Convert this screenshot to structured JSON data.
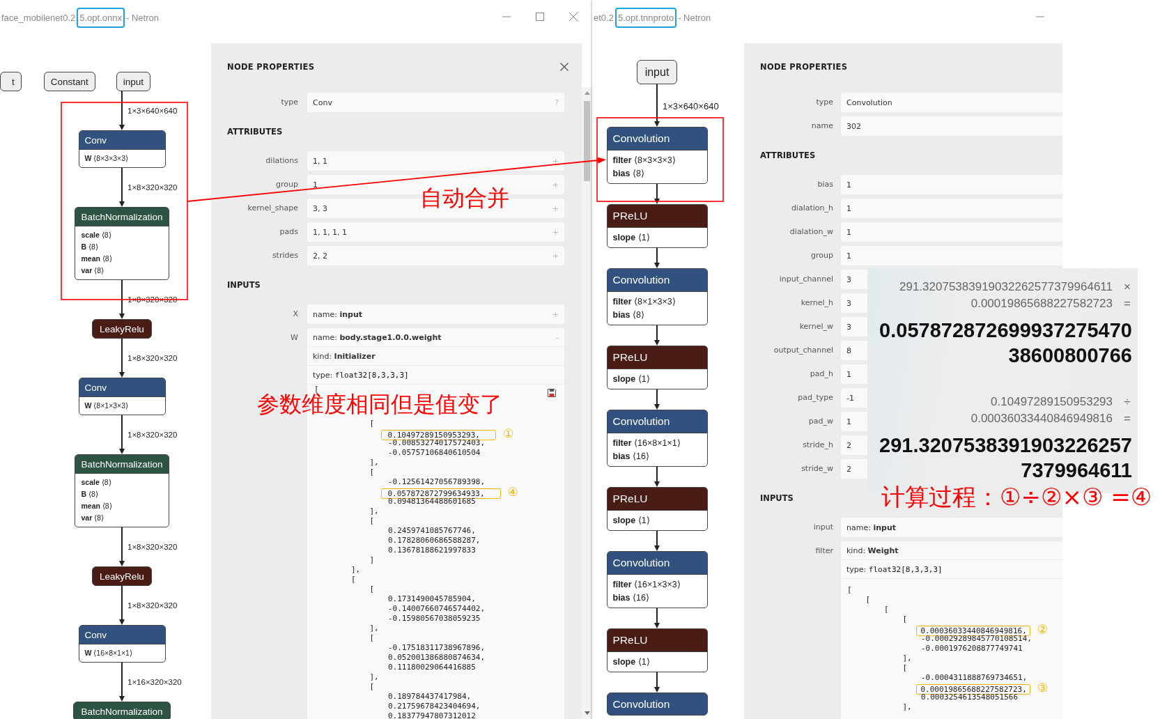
{
  "left_window": {
    "title": {
      "before": "face_mobilenet0.2",
      "highlighted": "5.opt.onnx",
      "after": " - Netron"
    },
    "controls": {
      "minimize": true,
      "maximize": true,
      "close": true
    },
    "graph": {
      "inputs": [
        {
          "label": "t"
        },
        {
          "label": "Constant"
        },
        {
          "label": "input"
        }
      ],
      "chain": [
        {
          "kind": "edge",
          "label": "1×3×640×640"
        },
        {
          "kind": "node",
          "color": "#31527f",
          "label": "Conv",
          "attributes": [
            "**W** ⟨8×3×3×3⟩"
          ]
        },
        {
          "kind": "edge",
          "label": "1×8×320×320"
        },
        {
          "kind": "node",
          "color": "#2d5342",
          "label": "BatchNormalization",
          "attributes": [
            "**scale** ⟨8⟩",
            "**B** ⟨8⟩",
            "**mean** ⟨8⟩",
            "**var** ⟨8⟩"
          ]
        },
        {
          "kind": "edge",
          "label": "1×8×320×320"
        },
        {
          "kind": "node",
          "color": "#4a1c16",
          "label": "LeakyRelu"
        },
        {
          "kind": "edge",
          "label": "1×8×320×320"
        },
        {
          "kind": "node",
          "color": "#31527f",
          "label": "Conv",
          "attributes": [
            "**W** ⟨8×1×3×3⟩"
          ]
        },
        {
          "kind": "edge",
          "label": "1×8×320×320"
        },
        {
          "kind": "node",
          "color": "#2d5342",
          "label": "BatchNormalization",
          "attributes": [
            "**scale** ⟨8⟩",
            "**B** ⟨8⟩",
            "**mean** ⟨8⟩",
            "**var** ⟨8⟩"
          ]
        },
        {
          "kind": "edge",
          "label": "1×8×320×320"
        },
        {
          "kind": "node",
          "color": "#4a1c16",
          "label": "LeakyRelu"
        },
        {
          "kind": "edge",
          "label": "1×8×320×320"
        },
        {
          "kind": "node",
          "color": "#31527f",
          "label": "Conv",
          "attributes": [
            "**W** ⟨16×8×1×1⟩"
          ]
        },
        {
          "kind": "edge",
          "label": "1×16×320×320"
        },
        {
          "kind": "node",
          "color": "#2d5342",
          "label": "BatchNormalization"
        }
      ]
    },
    "properties": {
      "title": "NODE PROPERTIES",
      "closable": true,
      "fields": [
        {
          "label": "type",
          "value": "Conv",
          "toggle": "?"
        }
      ],
      "sections": [
        {
          "title": "ATTRIBUTES",
          "fields": [
            {
              "label": "dilations",
              "value": "1, 1",
              "toggle": "+"
            },
            {
              "label": "group",
              "value": "1",
              "toggle": "+"
            },
            {
              "label": "kernel_shape",
              "value": "3, 3",
              "toggle": "+"
            },
            {
              "label": "pads",
              "value": "1, 1, 1, 1",
              "toggle": "+"
            },
            {
              "label": "strides",
              "value": "2, 2",
              "toggle": "+"
            }
          ]
        },
        {
          "title": "INPUTS",
          "fields": [
            {
              "label": "X",
              "value": "name: **input**",
              "toggle": "+"
            },
            {
              "label": "W",
              "toggle": "-",
              "lines": [
                {
                  "text": "name: **body.stage1.0.0.weight**",
                  "kind": "text"
                },
                {
                  "text": "kind: **Initializer**",
                  "kind": "text"
                },
                {
                  "text": "type: **float32[8,3,3,3]**",
                  "kind": "mono"
                }
              ],
              "code": {
                "saveable": true,
                "head": [
                  {
                    "text": "["
                  }
                ],
                "lines": [
                  {
                    "text": "            ["
                  },
                  {
                    "text": "                0.10497289150953293,",
                    "mark": "①"
                  },
                  {
                    "text": "                -0.00853274017572403,"
                  },
                  {
                    "text": "                -0.05757106840610504"
                  },
                  {
                    "text": "            ],"
                  },
                  {
                    "text": "            ["
                  },
                  {
                    "text": "                -0.12561427056789398,"
                  },
                  {
                    "text": "                0.057872872799634933,",
                    "mark": "④"
                  },
                  {
                    "text": "                0.09481364488601685"
                  },
                  {
                    "text": "            ],"
                  },
                  {
                    "text": "            ["
                  },
                  {
                    "text": "                0.2459741085767746,"
                  },
                  {
                    "text": "                0.17828060686588287,"
                  },
                  {
                    "text": "                0.13678188621997833"
                  },
                  {
                    "text": "            ]"
                  },
                  {
                    "text": "        ],"
                  },
                  {
                    "text": "        ["
                  },
                  {
                    "text": "            ["
                  },
                  {
                    "text": "                0.1731490045785904,"
                  },
                  {
                    "text": "                -0.14007660746574402,"
                  },
                  {
                    "text": "                -0.15980567038059235"
                  },
                  {
                    "text": "            ],"
                  },
                  {
                    "text": "            ["
                  },
                  {
                    "text": "                -0.17518311738967896,"
                  },
                  {
                    "text": "                0.052001386880874634,"
                  },
                  {
                    "text": "                0.11180029064416885"
                  },
                  {
                    "text": "            ],"
                  },
                  {
                    "text": "            ["
                  },
                  {
                    "text": "                0.189784437417984,"
                  },
                  {
                    "text": "                0.21759678423404694,"
                  },
                  {
                    "text": "                0.18377947807312012"
                  }
                ]
              }
            }
          ]
        }
      ]
    }
  },
  "right_window": {
    "title": {
      "before": "et0.2",
      "highlighted": "5.opt.tnnproto",
      "after": " - Netron"
    },
    "controls": {
      "minimize": true
    },
    "graph": {
      "inputs": [
        {
          "label": "input"
        }
      ],
      "chain": [
        {
          "kind": "edge",
          "label": "1×3×640×640"
        },
        {
          "kind": "node",
          "color": "#31527f",
          "label": "Convolution",
          "attributes": [
            "**filter** ⟨8×3×3×3⟩",
            "**bias** ⟨8⟩"
          ]
        },
        {
          "kind": "edge"
        },
        {
          "kind": "node",
          "color": "#4a1c16",
          "label": "PReLU",
          "attributes": [
            "**slope** ⟨1⟩"
          ]
        },
        {
          "kind": "edge"
        },
        {
          "kind": "node",
          "color": "#31527f",
          "label": "Convolution",
          "attributes": [
            "**filter** ⟨8×1×3×3⟩",
            "**bias** ⟨8⟩"
          ]
        },
        {
          "kind": "edge"
        },
        {
          "kind": "node",
          "color": "#4a1c16",
          "label": "PReLU",
          "attributes": [
            "**slope** ⟨1⟩"
          ]
        },
        {
          "kind": "edge"
        },
        {
          "kind": "node",
          "color": "#31527f",
          "label": "Convolution",
          "attributes": [
            "**filter** ⟨16×8×1×1⟩",
            "**bias** ⟨16⟩"
          ]
        },
        {
          "kind": "edge"
        },
        {
          "kind": "node",
          "color": "#4a1c16",
          "label": "PReLU",
          "attributes": [
            "**slope** ⟨1⟩"
          ]
        },
        {
          "kind": "edge"
        },
        {
          "kind": "node",
          "color": "#31527f",
          "label": "Convolution",
          "attributes": [
            "**filter** ⟨16×1×3×3⟩",
            "**bias** ⟨16⟩"
          ]
        },
        {
          "kind": "edge"
        },
        {
          "kind": "node",
          "color": "#4a1c16",
          "label": "PReLU",
          "attributes": [
            "**slope** ⟨1⟩"
          ]
        },
        {
          "kind": "edge"
        },
        {
          "kind": "node",
          "color": "#31527f",
          "label": "Convolution"
        }
      ]
    },
    "properties": {
      "title": "NODE PROPERTIES",
      "fields": [
        {
          "label": "type",
          "value": "Convolution"
        },
        {
          "label": "name",
          "value": "302"
        }
      ],
      "sections": [
        {
          "title": "ATTRIBUTES",
          "fields": [
            {
              "label": "bias",
              "value": "1"
            },
            {
              "label": "dialation_h",
              "value": "1"
            },
            {
              "label": "dialation_w",
              "value": "1"
            },
            {
              "label": "group",
              "value": "1"
            },
            {
              "label": "input_channel",
              "value": "3"
            },
            {
              "label": "kernel_h",
              "value": "3"
            },
            {
              "label": "kernel_w",
              "value": "3"
            },
            {
              "label": "output_channel",
              "value": "8"
            },
            {
              "label": "pad_h",
              "value": "1"
            },
            {
              "label": "pad_type",
              "value": "-1"
            },
            {
              "label": "pad_w",
              "value": "1"
            },
            {
              "label": "stride_h",
              "value": "2"
            },
            {
              "label": "stride_w",
              "value": "2"
            }
          ]
        },
        {
          "title": "INPUTS",
          "fields": [
            {
              "label": "input",
              "value": "name: **input**"
            },
            {
              "label": "filter",
              "lines": [
                {
                  "text": "kind: **Weight**",
                  "kind": "text"
                },
                {
                  "text": "type: **float32[8,3,3,3]**",
                  "kind": "mono"
                }
              ],
              "code": {
                "lines": [
                  {
                    "text": "["
                  },
                  {
                    "text": "    ["
                  },
                  {
                    "text": "        ["
                  },
                  {
                    "text": "            ["
                  },
                  {
                    "text": "                0.00036033440846949816,",
                    "mark": "②"
                  },
                  {
                    "text": "                -0.00029289845770108514,"
                  },
                  {
                    "text": "                -0.0001976208877749741"
                  },
                  {
                    "text": "            ],"
                  },
                  {
                    "text": "            ["
                  },
                  {
                    "text": "                -0.0004311888769734651,"
                  },
                  {
                    "text": "                0.00019865688227582723,",
                    "mark": "③"
                  },
                  {
                    "text": "                0.0003254613548051566"
                  },
                  {
                    "text": "            ],"
                  }
                ]
              }
            }
          ]
        }
      ]
    }
  },
  "calculator": {
    "history": [
      {
        "operands": [
          {
            "value": "291.32075383919032262577379964611",
            "operator": "×"
          },
          {
            "value": "0.00019865688227582723",
            "operator": "="
          }
        ],
        "result_lines": [
          "0.057872872699937275470",
          "38600800766"
        ]
      },
      {
        "operands": [
          {
            "value": "0.10497289150953293",
            "operator": "÷"
          },
          {
            "value": "0.00036033440846949816",
            "operator": "="
          }
        ],
        "result_lines": [
          "291.3207538391903226257",
          "7379964611"
        ]
      }
    ]
  },
  "annotations": [
    {
      "text": "自动合并"
    },
    {
      "text": "参数维度相同但是值变了"
    },
    {
      "text": "计算过程：①÷②×③ =④"
    }
  ]
}
